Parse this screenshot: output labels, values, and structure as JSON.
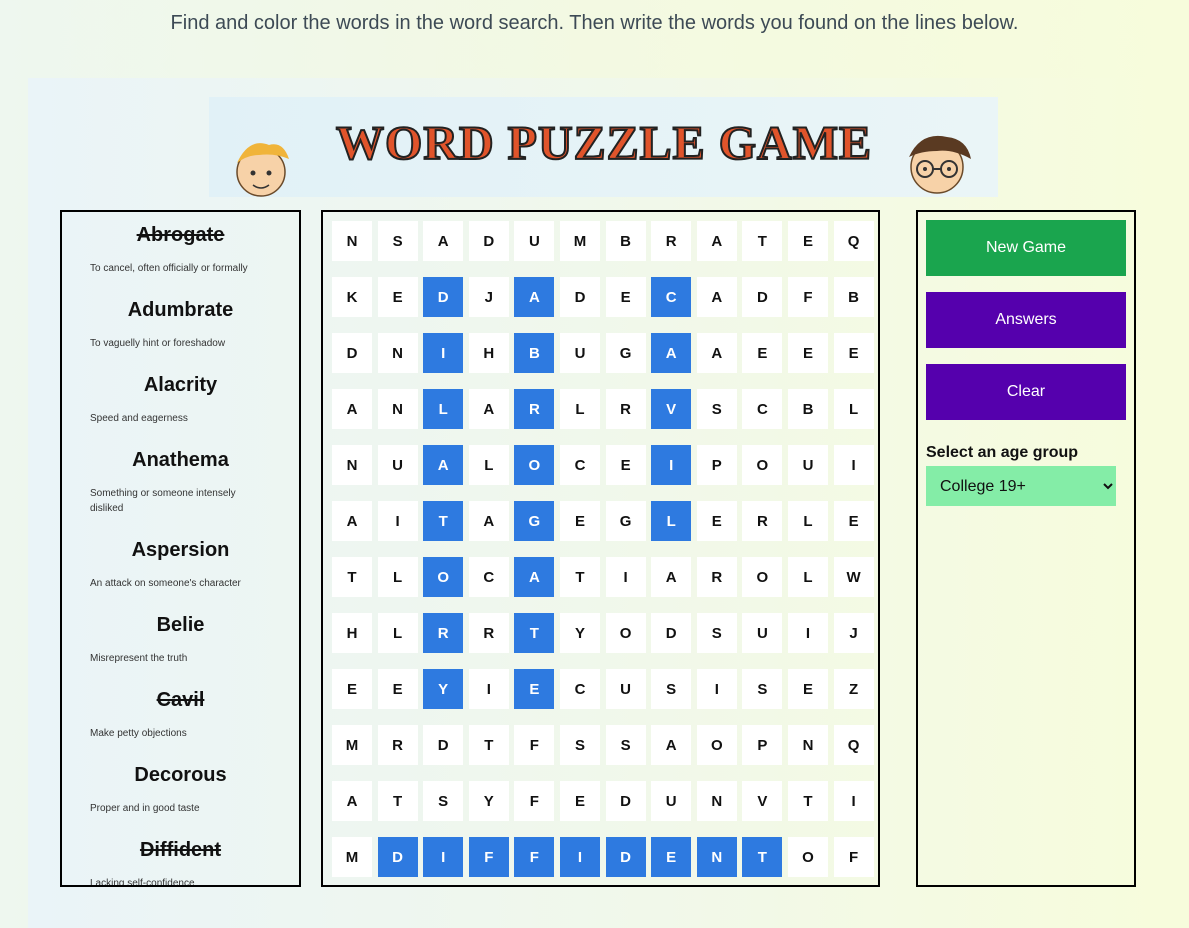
{
  "instructions": "Find and color the words in the word search. Then write the words you found on the lines below.",
  "logo": {
    "title": "WORD PUZZLE GAME"
  },
  "words": [
    {
      "word": "Abrogate",
      "definition": "To cancel, often officially or formally",
      "found": true
    },
    {
      "word": "Adumbrate",
      "definition": "To vaguelly hint or foreshadow",
      "found": false
    },
    {
      "word": "Alacrity",
      "definition": "Speed and eagerness",
      "found": false
    },
    {
      "word": "Anathema",
      "definition": "Something or someone intensely disliked",
      "found": false
    },
    {
      "word": "Aspersion",
      "definition": "An attack on someone's character",
      "found": false
    },
    {
      "word": "Belie",
      "definition": "Misrepresent the truth",
      "found": false
    },
    {
      "word": "Cavil",
      "definition": "Make petty objections",
      "found": true
    },
    {
      "word": "Decorous",
      "definition": "Proper and in good taste",
      "found": false
    },
    {
      "word": "Diffident",
      "definition": "Lacking self-confidence",
      "found": true
    }
  ],
  "grid": [
    "NSADUMBRATEQ",
    "KEDJADECADFB",
    "DNIHBUGAAEEE",
    "ANLARLRVSCBL",
    "NUALOCEIPOUI",
    "AITAGEGLERLE",
    "TLOCATIAROLW",
    "HLRRTYODSUIJ",
    "EEYIECUSISEZ",
    "MRDTFSSAOPNQ",
    "ATSYFEDUNVTI",
    "MDIFFIDENTOF"
  ],
  "highlighted": [
    [
      1,
      2
    ],
    [
      2,
      2
    ],
    [
      3,
      2
    ],
    [
      4,
      2
    ],
    [
      5,
      2
    ],
    [
      6,
      2
    ],
    [
      7,
      2
    ],
    [
      8,
      2
    ],
    [
      1,
      4
    ],
    [
      2,
      4
    ],
    [
      3,
      4
    ],
    [
      4,
      4
    ],
    [
      5,
      4
    ],
    [
      6,
      4
    ],
    [
      7,
      4
    ],
    [
      8,
      4
    ],
    [
      1,
      7
    ],
    [
      2,
      7
    ],
    [
      3,
      7
    ],
    [
      4,
      7
    ],
    [
      5,
      7
    ],
    [
      11,
      1
    ],
    [
      11,
      2
    ],
    [
      11,
      3
    ],
    [
      11,
      4
    ],
    [
      11,
      5
    ],
    [
      11,
      6
    ],
    [
      11,
      7
    ],
    [
      11,
      8
    ],
    [
      11,
      9
    ]
  ],
  "controls": {
    "new_game": "New Game",
    "answers": "Answers",
    "clear": "Clear",
    "age_label": "Select an age group",
    "age_selected": "College 19+"
  },
  "colors": {
    "highlight": "#2e7ae0",
    "new_game": "#1aa54e",
    "buttons": "#5500ad",
    "select": "#84eda7"
  }
}
